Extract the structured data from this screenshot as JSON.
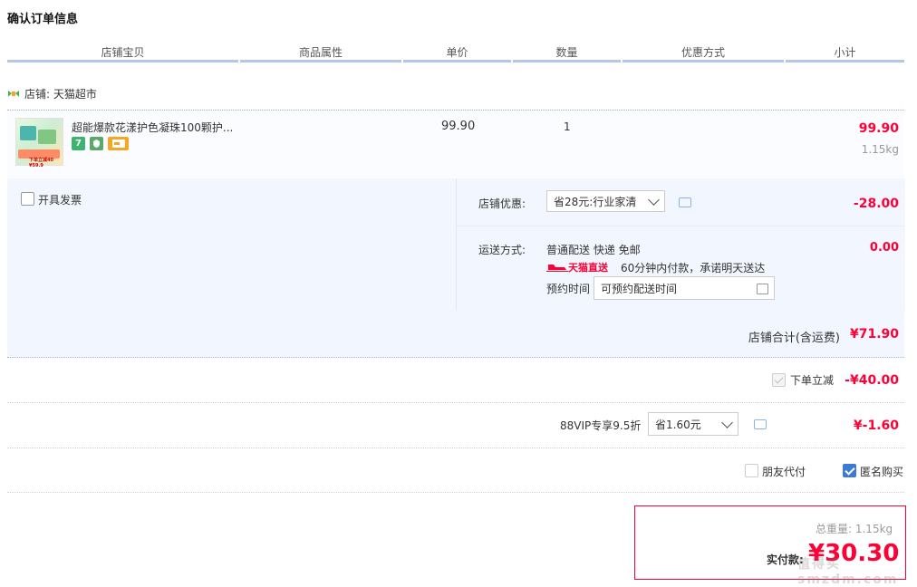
{
  "page_title": "确认订单信息",
  "columns": [
    "店铺宝贝",
    "商品属性",
    "单价",
    "数量",
    "优惠方式",
    "小计"
  ],
  "shop": {
    "label": "店铺: 天猫超市"
  },
  "item": {
    "title": "超能爆款花漾护色凝珠100颗护...",
    "thumb_text": "下单立减40 ¥59.9",
    "unit_price": "99.90",
    "quantity": "1",
    "subtotal": "99.90",
    "weight": "1.15kg"
  },
  "invoice": {
    "label": "开具发票"
  },
  "shop_discount": {
    "label": "店铺优惠:",
    "selected": "省28元:行业家清",
    "amount": "-28.00"
  },
  "shipping": {
    "label": "运送方式:",
    "method": "普通配送 快递 免邮",
    "tmall_direct": "天猫直送",
    "promise": "60分钟内付款，承诺明天送达",
    "schedule_label": "预约时间",
    "schedule_value": "可预约配送时间",
    "fee": "0.00"
  },
  "shop_total": {
    "label": "店铺合计(含运费)",
    "value": "¥71.90"
  },
  "instant_discount": {
    "label": "下单立减",
    "value": "-¥40.00"
  },
  "vip": {
    "label": "88VIP专享9.5折",
    "selected": "省1.60元",
    "value": "¥-1.60"
  },
  "options": {
    "friend_pay": "朋友代付",
    "anonymous": "匿名购买"
  },
  "summary": {
    "partial_label": "实付款:",
    "amount": "¥30.30",
    "weight_partial": "总重量: 1.15kg"
  },
  "watermark": "值得买 smzdm.com",
  "colors": {
    "accent_red": "#ff0036",
    "header_line": "#b3c8e6",
    "panel_bg": "#f2f7ff",
    "checkbox_blue": "#3b7bd6"
  }
}
